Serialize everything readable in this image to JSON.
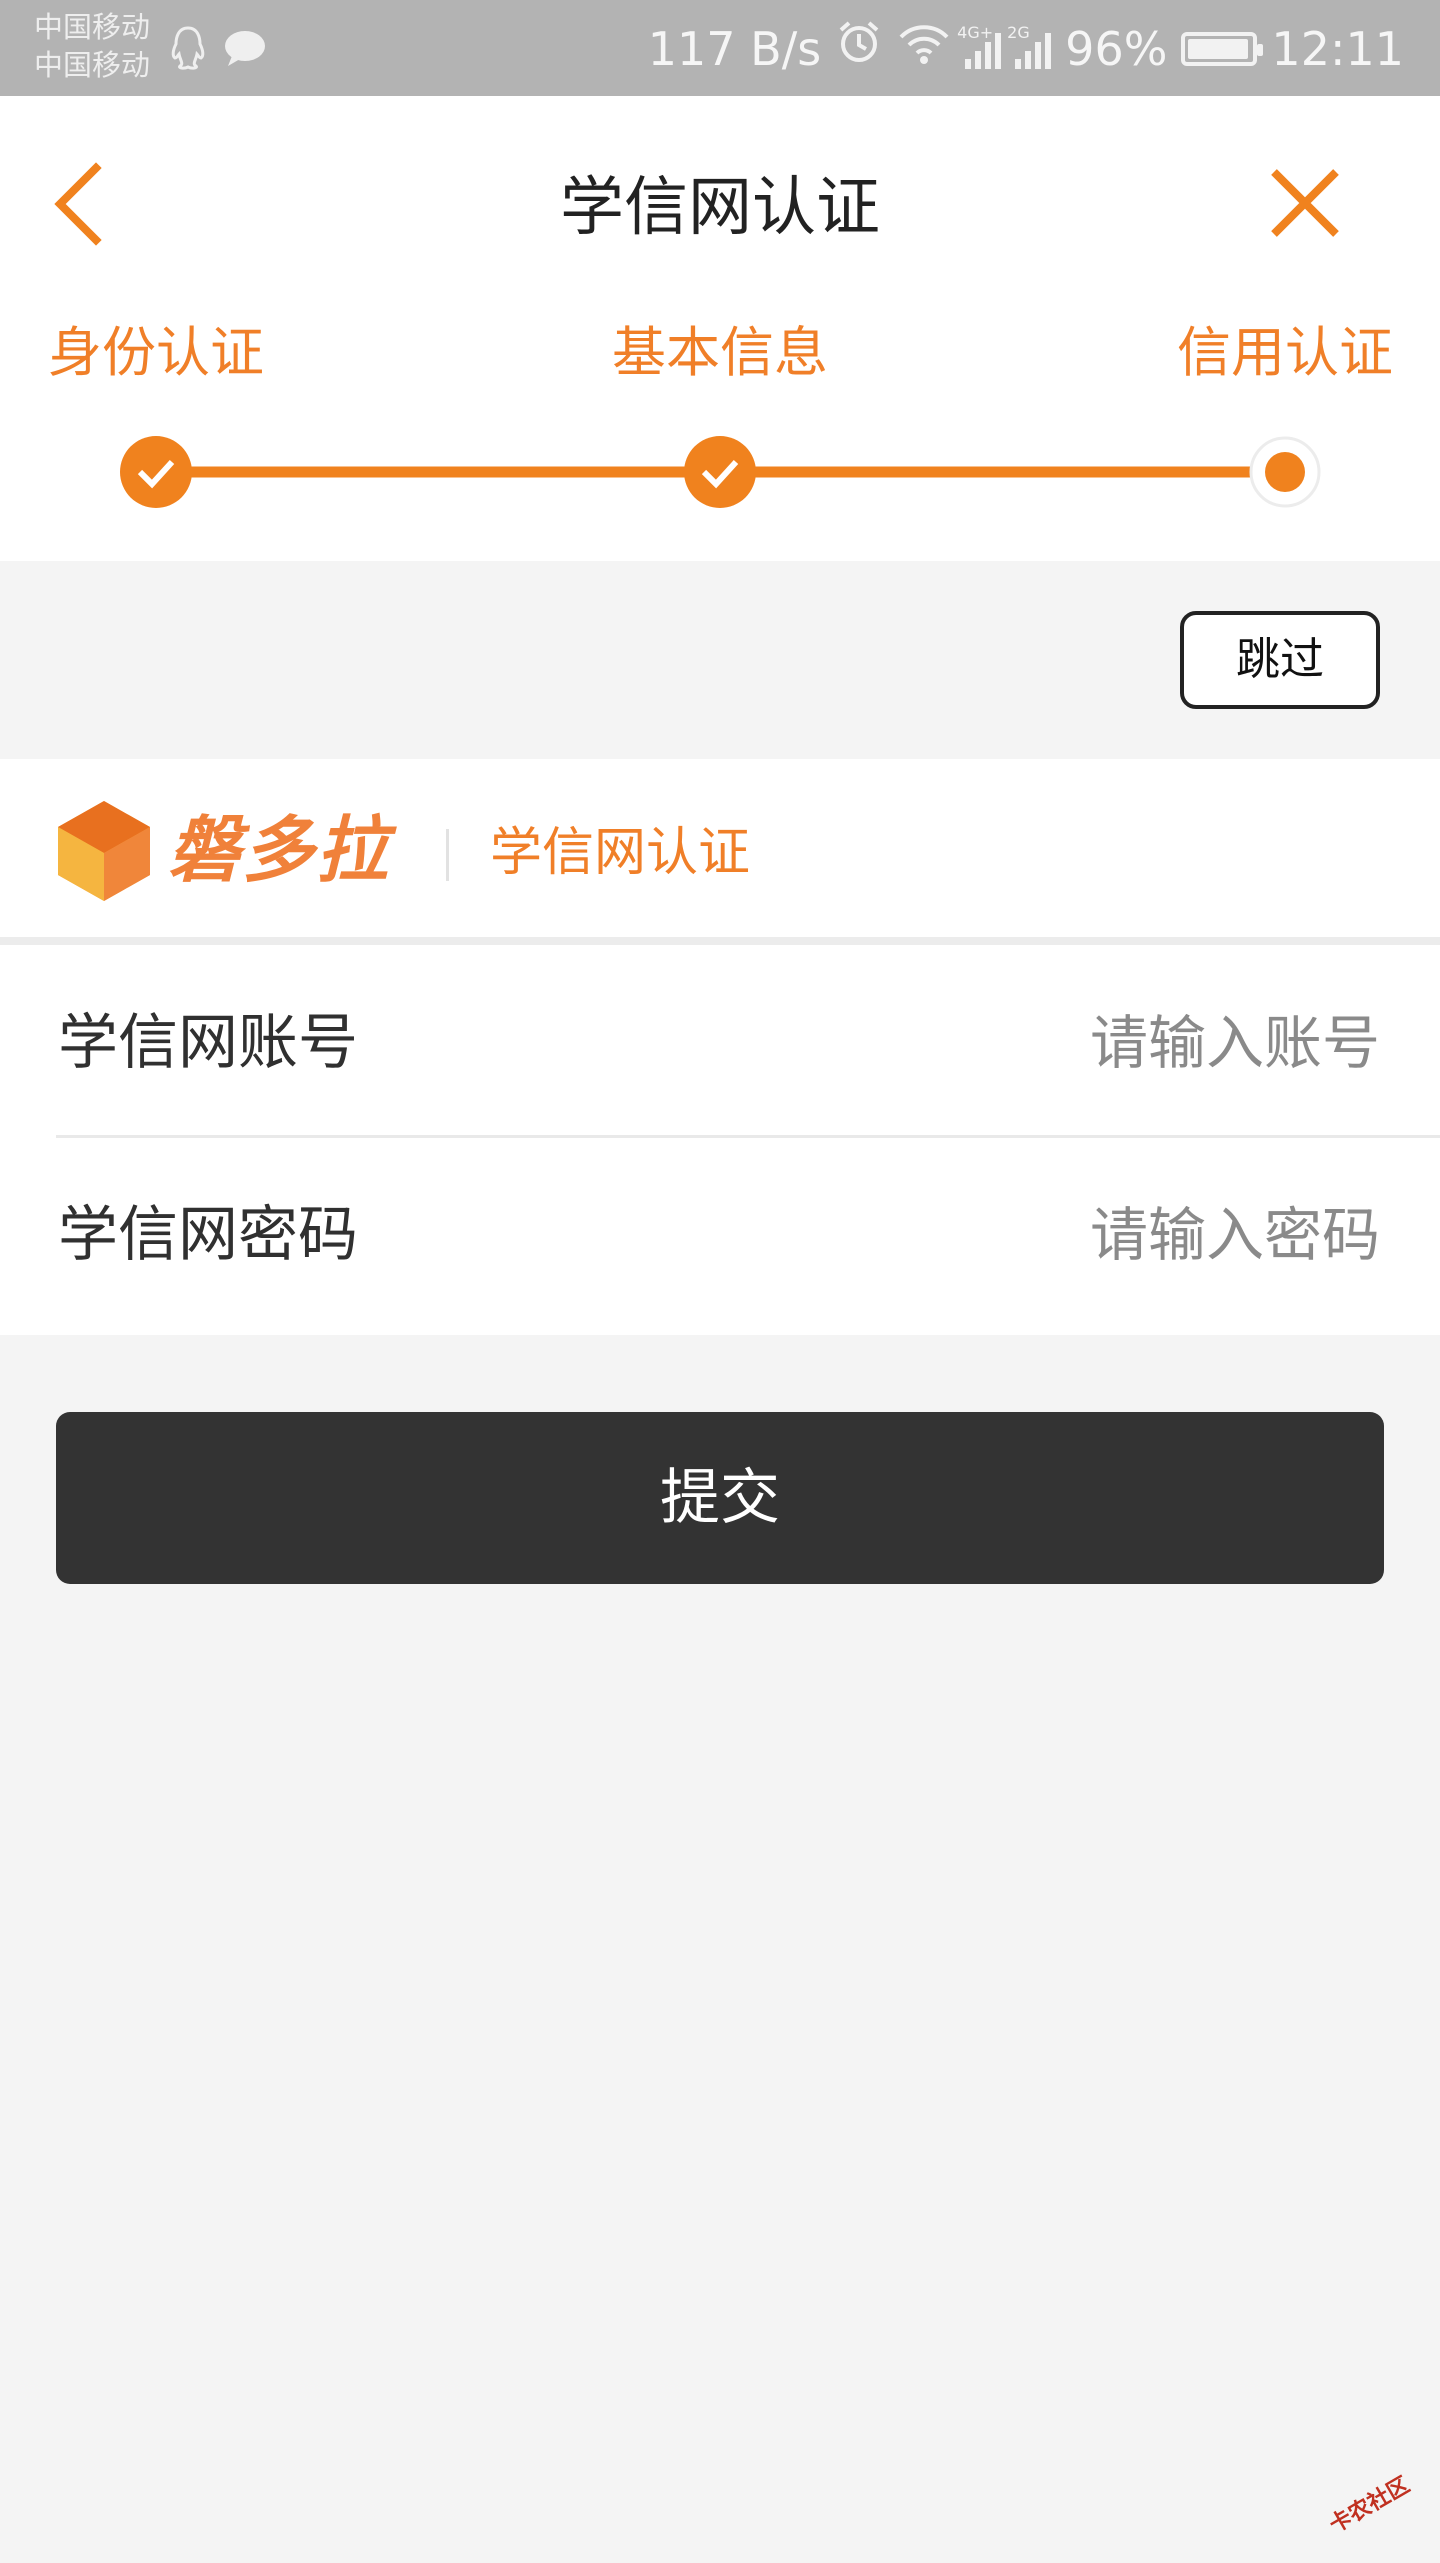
{
  "status_bar": {
    "carrier_1": "中国移动",
    "carrier_2": "中国移动",
    "net_speed": "117 B/s",
    "net_tag_1": "4G+",
    "net_tag_2": "2G",
    "battery": "96%",
    "battery_level": 0.96,
    "time": "12:11",
    "icons": [
      "qq-icon",
      "chat-bubble-icon",
      "alarm-icon",
      "wifi-icon",
      "signal-icon",
      "battery-icon"
    ]
  },
  "header": {
    "title": "学信网认证",
    "back_icon": "chevron-left-icon",
    "close_icon": "close-icon"
  },
  "steps": [
    {
      "label": "身份认证",
      "status": "done"
    },
    {
      "label": "基本信息",
      "status": "done"
    },
    {
      "label": "信用认证",
      "status": "current"
    }
  ],
  "skip_label": "跳过",
  "brand": {
    "name": "磐多拉",
    "subtitle": "学信网认证",
    "logo_icon": "hexagon-logo-icon"
  },
  "form": {
    "account": {
      "label": "学信网账号",
      "placeholder": "请输入账号",
      "value": ""
    },
    "password": {
      "label": "学信网密码",
      "placeholder": "请输入密码",
      "value": ""
    }
  },
  "submit_label": "提交",
  "watermark": "卡农社区",
  "colors": {
    "accent": "#f0821e",
    "status_bar": "#b3b3b3",
    "button_dark": "#333333",
    "background": "#f4f4f4"
  }
}
